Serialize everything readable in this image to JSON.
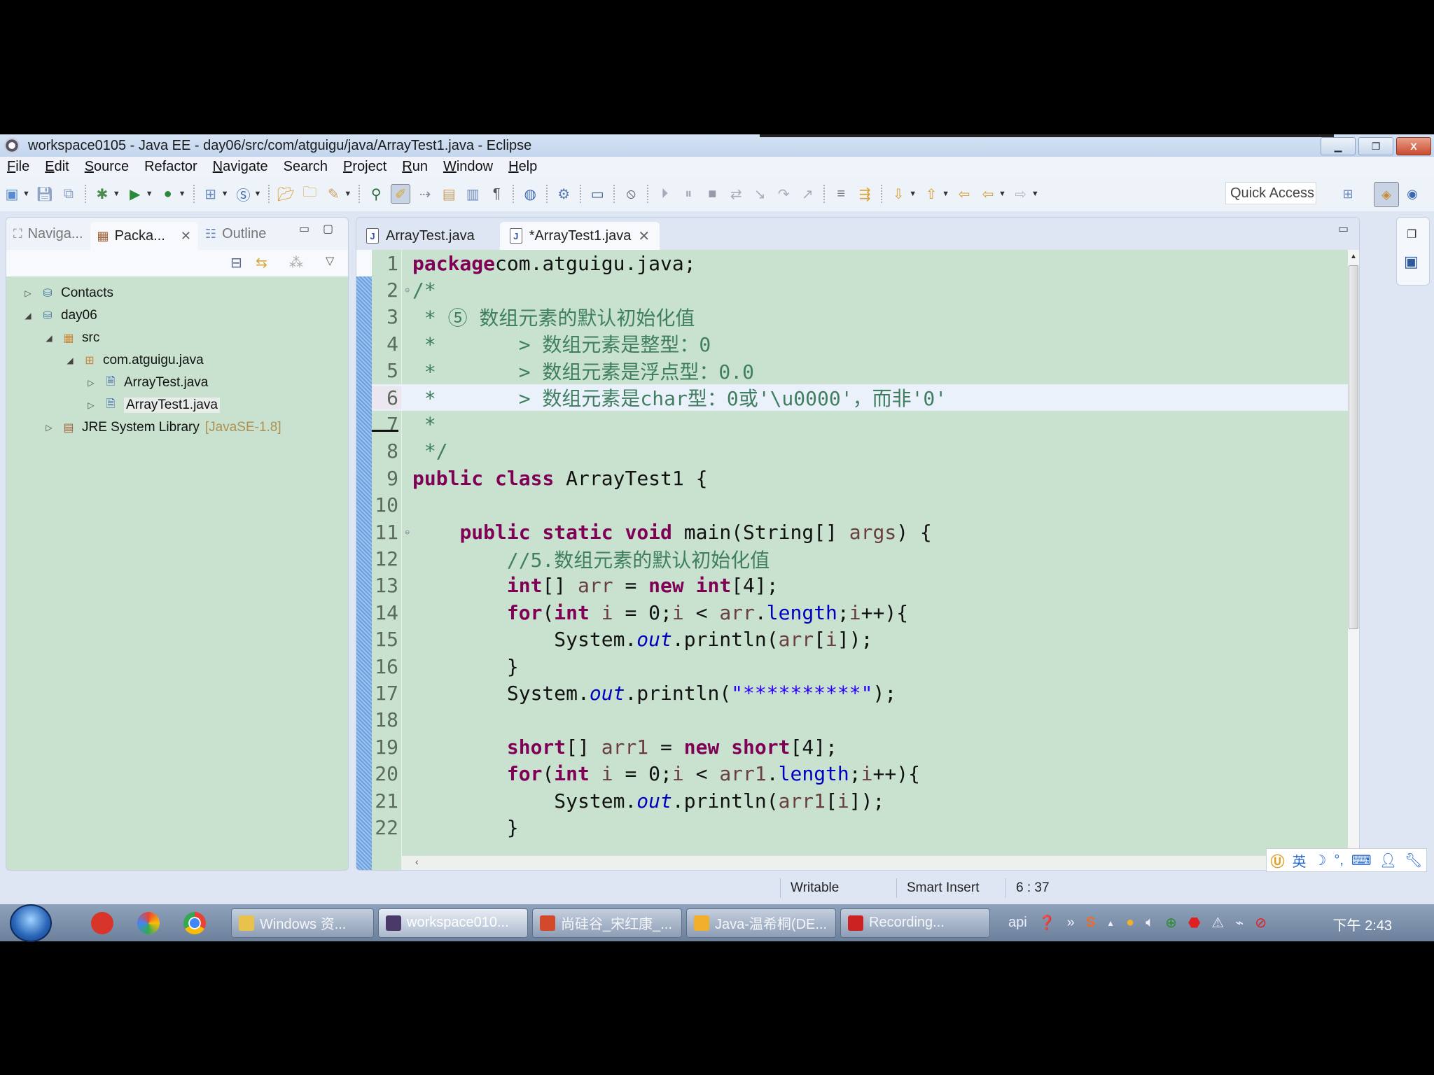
{
  "window": {
    "title": "workspace0105 - Java EE - day06/src/com/atguigu/java/ArrayTest1.java - Eclipse",
    "minimize_icon": "minimize-icon",
    "restore_icon": "restore-icon",
    "close_icon": "close-icon"
  },
  "menu": [
    {
      "label": "File",
      "mnemonic": "F",
      "rest": "ile"
    },
    {
      "label": "Edit",
      "mnemonic": "E",
      "rest": "dit"
    },
    {
      "label": "Source",
      "mnemonic": "S",
      "rest": "ource"
    },
    {
      "label": "Refactor",
      "mnemonic": "",
      "rest": "Refactor"
    },
    {
      "label": "Navigate",
      "mnemonic": "N",
      "rest": "avigate"
    },
    {
      "label": "Search",
      "mnemonic": "",
      "rest": "Search"
    },
    {
      "label": "Project",
      "mnemonic": "P",
      "rest": "roject"
    },
    {
      "label": "Run",
      "mnemonic": "R",
      "rest": "un"
    },
    {
      "label": "Window",
      "mnemonic": "W",
      "rest": "indow"
    },
    {
      "label": "Help",
      "mnemonic": "H",
      "rest": "elp"
    }
  ],
  "toolbar": {
    "quick_access_placeholder": "Quick Access"
  },
  "left_panel": {
    "tabs": [
      {
        "label": "Naviga...",
        "icon": "navigator-icon",
        "active": false
      },
      {
        "label": "Packa...",
        "icon": "package-explorer-icon",
        "active": true
      },
      {
        "label": "Outline",
        "icon": "outline-icon",
        "active": false
      }
    ],
    "tree": [
      {
        "label": "Contacts",
        "depth": 0,
        "expanded": false,
        "icon": "project-icon"
      },
      {
        "label": "day06",
        "depth": 0,
        "expanded": true,
        "icon": "project-icon"
      },
      {
        "label": "src",
        "depth": 1,
        "expanded": true,
        "icon": "source-folder-icon"
      },
      {
        "label": "com.atguigu.java",
        "depth": 2,
        "expanded": true,
        "icon": "package-icon"
      },
      {
        "label": "ArrayTest.java",
        "depth": 3,
        "expanded": false,
        "icon": "java-file-icon"
      },
      {
        "label": "ArrayTest1.java",
        "depth": 3,
        "expanded": false,
        "icon": "java-file-icon",
        "selected": true
      },
      {
        "label": "JRE System Library",
        "decoration": "[JavaSE-1.8]",
        "depth": 1,
        "expanded": false,
        "icon": "library-icon"
      }
    ]
  },
  "editor": {
    "tabs": [
      {
        "label": "ArrayTest.java",
        "active": false
      },
      {
        "label": "*ArrayTest1.java",
        "active": true
      }
    ],
    "current_line": 6,
    "lines": [
      [
        [
          "kw",
          "package"
        ],
        [
          "",
          "com.atguigu.java;"
        ]
      ],
      [
        [
          "cm",
          "/*"
        ]
      ],
      [
        [
          "cm",
          " * ⑤ 数组元素的默认初始化值"
        ]
      ],
      [
        [
          "cm",
          " *       > 数组元素是整型：0"
        ]
      ],
      [
        [
          "cm",
          " *       > 数组元素是浮点型：0.0"
        ]
      ],
      [
        [
          "cm",
          " *       > 数组元素是char型：0或'\\u0000'，而非'0'"
        ]
      ],
      [
        [
          "cm",
          " *"
        ]
      ],
      [
        [
          "cm",
          " */"
        ]
      ],
      [
        [
          "kw",
          "public "
        ],
        [
          "kw",
          "class "
        ],
        [
          "",
          "ArrayTest1 {"
        ]
      ],
      [
        [
          "",
          ""
        ]
      ],
      [
        [
          "",
          "    "
        ],
        [
          "kw",
          "public "
        ],
        [
          "kw",
          "static "
        ],
        [
          "kw",
          "void "
        ],
        [
          "",
          "main(String[] "
        ],
        [
          "var",
          "args"
        ],
        [
          "",
          ") {"
        ]
      ],
      [
        [
          "",
          "        "
        ],
        [
          "cm",
          "//5.数组元素的默认初始化值"
        ]
      ],
      [
        [
          "",
          "        "
        ],
        [
          "kw",
          "int"
        ],
        [
          "",
          "[] "
        ],
        [
          "var",
          "arr"
        ],
        [
          "",
          " = "
        ],
        [
          "kw",
          "new "
        ],
        [
          "kw",
          "int"
        ],
        [
          "",
          "[4];"
        ]
      ],
      [
        [
          "",
          "        "
        ],
        [
          "kw",
          "for"
        ],
        [
          "",
          "("
        ],
        [
          "kw",
          "int "
        ],
        [
          "var",
          "i"
        ],
        [
          "",
          " = 0;"
        ],
        [
          "var",
          "i"
        ],
        [
          "",
          " < "
        ],
        [
          "var",
          "arr"
        ],
        [
          "",
          "."
        ],
        [
          "fld",
          "length"
        ],
        [
          "",
          ";"
        ],
        [
          "var",
          "i"
        ],
        [
          "",
          "++){"
        ]
      ],
      [
        [
          "",
          "            System."
        ],
        [
          "sfld",
          "out"
        ],
        [
          "",
          ".println("
        ],
        [
          "var",
          "arr"
        ],
        [
          "",
          "["
        ],
        [
          "var",
          "i"
        ],
        [
          "",
          "]);"
        ]
      ],
      [
        [
          "",
          "        }"
        ]
      ],
      [
        [
          "",
          "        System."
        ],
        [
          "sfld",
          "out"
        ],
        [
          "",
          ".println("
        ],
        [
          "str",
          "\"**********\""
        ],
        [
          "",
          ");"
        ]
      ],
      [
        [
          "",
          ""
        ]
      ],
      [
        [
          "",
          "        "
        ],
        [
          "kw",
          "short"
        ],
        [
          "",
          "[] "
        ],
        [
          "var",
          "arr1"
        ],
        [
          "",
          " = "
        ],
        [
          "kw",
          "new "
        ],
        [
          "kw",
          "short"
        ],
        [
          "",
          "[4];"
        ]
      ],
      [
        [
          "",
          "        "
        ],
        [
          "kw",
          "for"
        ],
        [
          "",
          "("
        ],
        [
          "kw",
          "int "
        ],
        [
          "var",
          "i"
        ],
        [
          "",
          " = 0;"
        ],
        [
          "var",
          "i"
        ],
        [
          "",
          " < "
        ],
        [
          "var",
          "arr1"
        ],
        [
          "",
          "."
        ],
        [
          "fld",
          "length"
        ],
        [
          "",
          ";"
        ],
        [
          "var",
          "i"
        ],
        [
          "",
          "++){"
        ]
      ],
      [
        [
          "",
          "            System."
        ],
        [
          "sfld",
          "out"
        ],
        [
          "",
          ".println("
        ],
        [
          "var",
          "arr1"
        ],
        [
          "",
          "["
        ],
        [
          "var",
          "i"
        ],
        [
          "",
          "]);"
        ]
      ],
      [
        [
          "",
          "        }"
        ]
      ]
    ]
  },
  "ime": {
    "mode": "英"
  },
  "status": {
    "writable": "Writable",
    "insert_mode": "Smart Insert",
    "position": "6 : 37"
  },
  "taskbar": {
    "tasks": [
      {
        "label": "Windows 资...",
        "active": false,
        "color": "#e8c24a"
      },
      {
        "label": "workspace010...",
        "active": true,
        "color": "#4a3a6a"
      },
      {
        "label": "尚硅谷_宋红康_...",
        "active": false,
        "color": "#d24a2a"
      },
      {
        "label": "Java-温希桐(DE...",
        "active": false,
        "color": "#f2b02a"
      },
      {
        "label": "Recording...",
        "active": false,
        "color": "#c22"
      }
    ],
    "tray_text": "api",
    "clock": "下午 2:43"
  }
}
